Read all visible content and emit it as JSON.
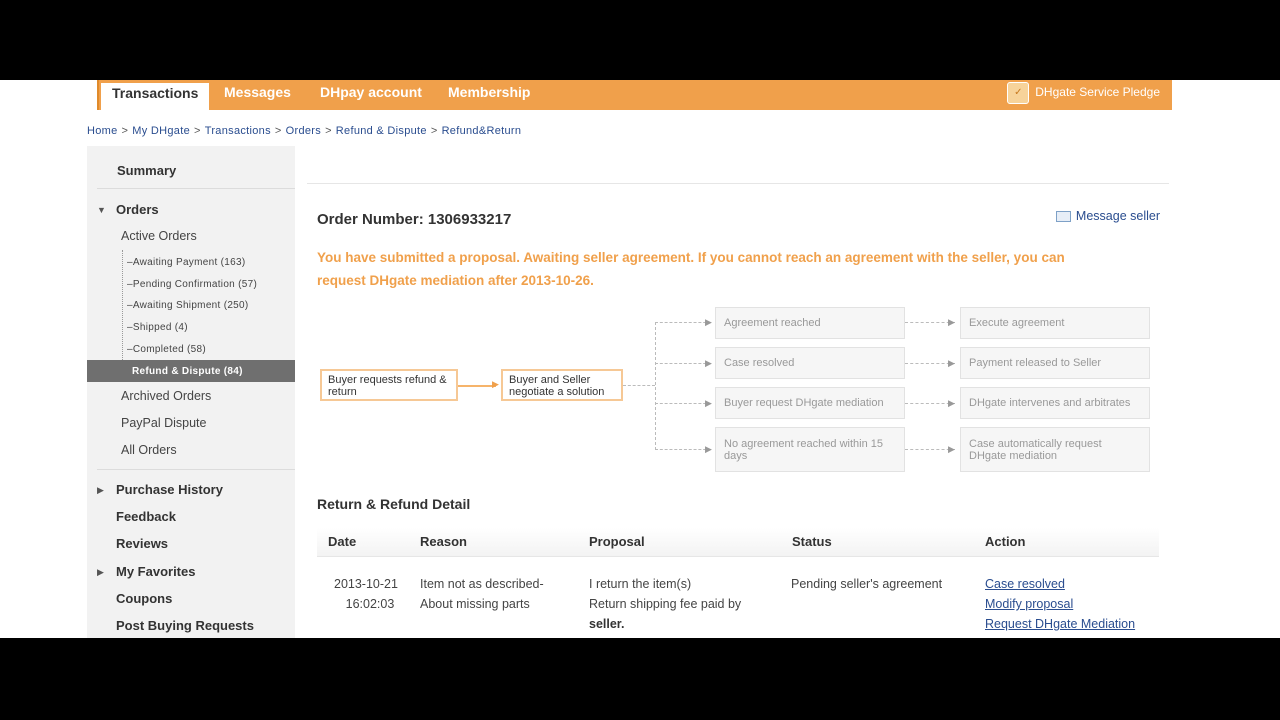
{
  "nav": {
    "tabs": [
      "Transactions",
      "Messages",
      "DHpay account",
      "Membership"
    ],
    "pledge": "DHgate Service Pledge"
  },
  "breadcrumb": [
    "Home",
    "My DHgate",
    "Transactions",
    "Orders",
    "Refund & Dispute",
    "Refund&Return"
  ],
  "sidebar": {
    "summary": "Summary",
    "orders": "Orders",
    "active_orders": "Active Orders",
    "sub": [
      "Awaiting Payment (163)",
      "Pending Confirmation (57)",
      "Awaiting Shipment (250)",
      "Shipped (4)",
      "Completed (58)",
      "Refund & Dispute (84)"
    ],
    "archived_orders": "Archived Orders",
    "paypal_dispute": "PayPal Dispute",
    "all_orders": "All Orders",
    "purchase_history": "Purchase History",
    "feedback": "Feedback",
    "reviews": "Reviews",
    "my_favorites": "My Favorites",
    "coupons": "Coupons",
    "post_buying_requests": "Post Buying Requests"
  },
  "main": {
    "order_label": "Order Number:",
    "order_number": "1306933217",
    "message_seller": "Message seller",
    "notice_line1": "You have submitted a proposal. Awaiting seller agreement. If you cannot reach an agreement with the seller, you can",
    "notice_line2": "request DHgate mediation after 2013-10-26."
  },
  "flow": {
    "start": "Buyer requests refund & return",
    "negotiate": "Buyer and Seller negotiate a solution",
    "outcomes": [
      "Agreement reached",
      "Case resolved",
      "Buyer request DHgate mediation",
      "No agreement reached within 15 days"
    ],
    "results": [
      "Execute agreement",
      "Payment released to Seller",
      "DHgate intervenes and arbitrates",
      "Case automatically request DHgate mediation"
    ]
  },
  "detail": {
    "title": "Return & Refund Detail",
    "columns": [
      "Date",
      "Reason",
      "Proposal",
      "Status",
      "Action"
    ],
    "row": {
      "date": "2013-10-21",
      "time": "16:02:03",
      "reason1": "Item not as described-",
      "reason2": "About missing parts",
      "proposal1": "I return the item(s)",
      "proposal2": "Return shipping fee paid by",
      "proposal3": "seller.",
      "status": "Pending seller's agreement",
      "actions": [
        "Case resolved",
        "Modify proposal",
        "Request DHgate Mediation"
      ]
    }
  }
}
